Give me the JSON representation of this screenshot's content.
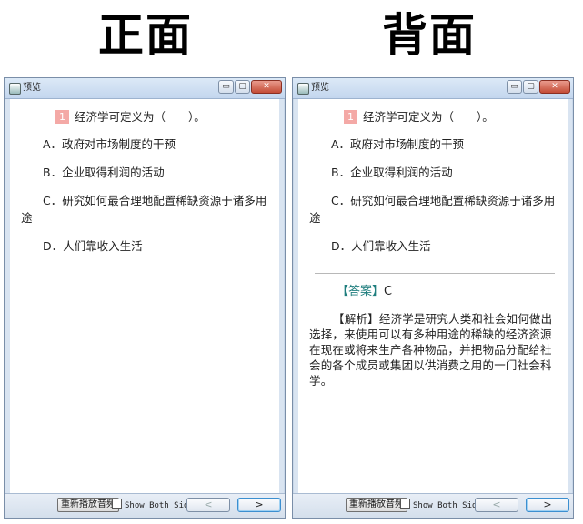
{
  "headings": {
    "front": "正面",
    "back": "背面"
  },
  "window": {
    "title": "预览",
    "controls": {
      "minimize": "▭",
      "maximize": "▢",
      "close": "✕"
    }
  },
  "question": {
    "number": "1",
    "stem": "经济学可定义为（　　）。",
    "options": [
      "A．政府对市场制度的干预",
      "B．企业取得利润的活动",
      "C．研究如何最合理地配置稀缺资源于诸多用途",
      "D．人们靠收入生活"
    ]
  },
  "answer": {
    "label": "【答案】",
    "value": "C"
  },
  "explanation": {
    "label": "【解析】",
    "text": "经济学是研究人类和社会如何做出选择，来使用可以有多种用途的稀缺的经济资源在现在或将来生产各种物品，并把物品分配给社会的各个成员或集团以供消费之用的一门社会科学。"
  },
  "bottombar": {
    "replay_label": "重新播放音频",
    "show_both_label": "Show Both Sides",
    "prev_label": "<",
    "next_label": ">"
  },
  "colors": {
    "number_badge": "#f4a9a6",
    "bracket": "#1f7e7e"
  }
}
